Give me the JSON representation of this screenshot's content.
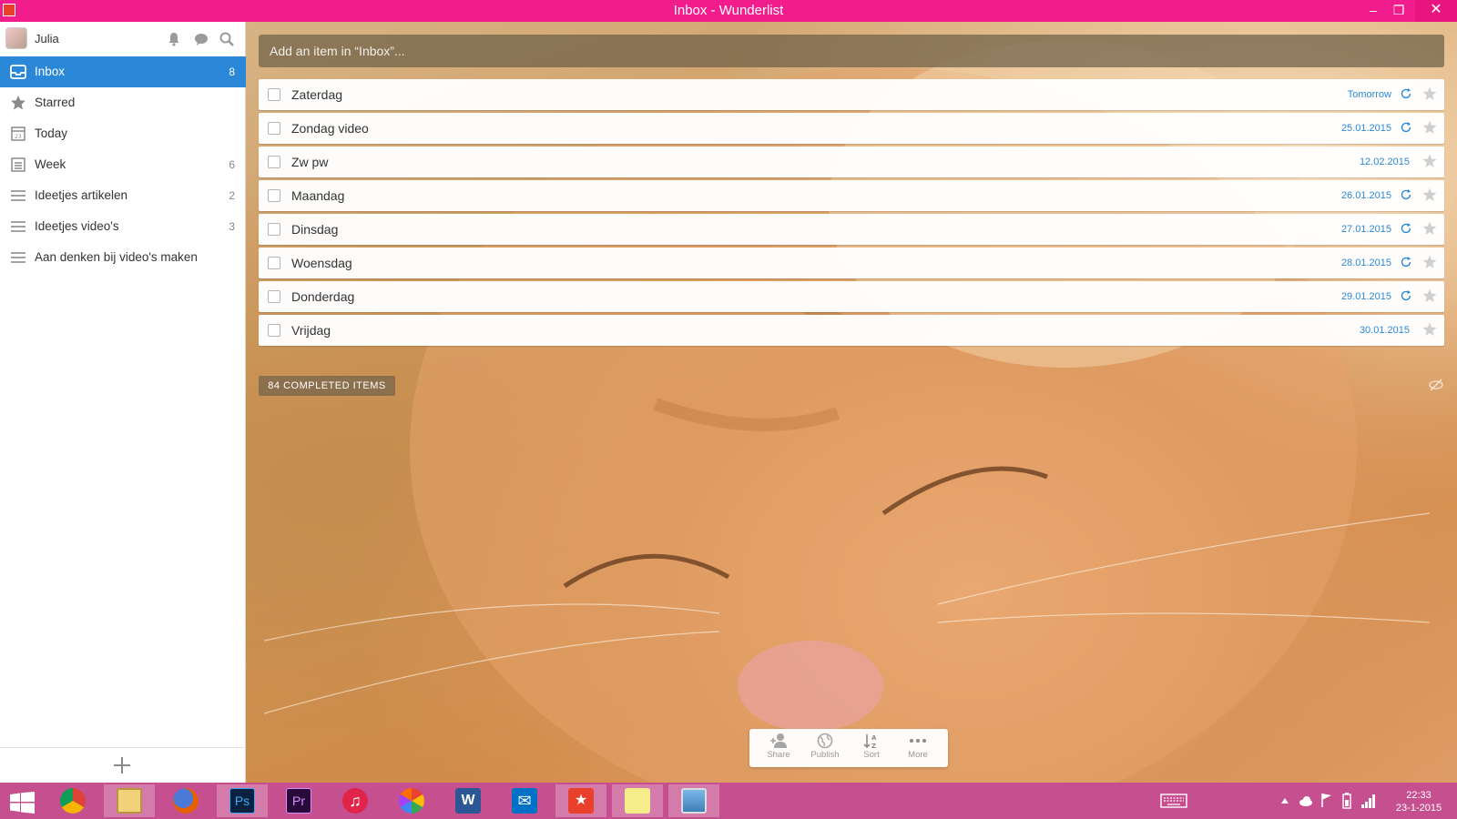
{
  "window": {
    "title": "Inbox - Wunderlist",
    "minimize": "–",
    "maximize": "❐",
    "close": "✕"
  },
  "user": {
    "name": "Julia"
  },
  "sidebar": {
    "items": [
      {
        "label": "Inbox",
        "count": "8",
        "icon": "inbox-icon",
        "active": true
      },
      {
        "label": "Starred",
        "count": "",
        "icon": "star-icon"
      },
      {
        "label": "Today",
        "count": "",
        "icon": "calendar-icon"
      },
      {
        "label": "Week",
        "count": "6",
        "icon": "week-icon"
      },
      {
        "label": "Ideetjes artikelen",
        "count": "2",
        "icon": "list-icon"
      },
      {
        "label": "Ideetjes video's",
        "count": "3",
        "icon": "list-icon"
      },
      {
        "label": "Aan denken bij video's maken",
        "count": "",
        "icon": "list-icon"
      }
    ],
    "add_list_icon": "plus-icon"
  },
  "main": {
    "add_placeholder": "Add an item in “Inbox”...",
    "tasks": [
      {
        "name": "Zaterdag",
        "due": "Tomorrow",
        "recurring": true
      },
      {
        "name": "Zondag video",
        "due": "25.01.2015",
        "recurring": true
      },
      {
        "name": "Zw pw",
        "due": "12.02.2015",
        "recurring": false
      },
      {
        "name": "Maandag",
        "due": "26.01.2015",
        "recurring": true
      },
      {
        "name": "Dinsdag",
        "due": "27.01.2015",
        "recurring": true
      },
      {
        "name": "Woensdag",
        "due": "28.01.2015",
        "recurring": true
      },
      {
        "name": "Donderdag",
        "due": "29.01.2015",
        "recurring": true
      },
      {
        "name": "Vrijdag",
        "due": "30.01.2015",
        "recurring": false
      }
    ],
    "completed_label": "84 COMPLETED ITEMS",
    "toolbar": {
      "share": "Share",
      "publish": "Publish",
      "sort": "Sort",
      "more": "More"
    }
  },
  "taskbar": {
    "apps": [
      "start",
      "chrome",
      "file-explorer",
      "firefox",
      "photoshop",
      "premiere",
      "itunes",
      "picasa",
      "word",
      "mail",
      "wunderlist",
      "sticky-notes",
      "photos"
    ],
    "clock_time": "22:33",
    "clock_date": "23-1-2015"
  },
  "colors": {
    "title_bar": "#f21d8c",
    "accent": "#2b88d9",
    "taskbar": "#c64f8f"
  }
}
